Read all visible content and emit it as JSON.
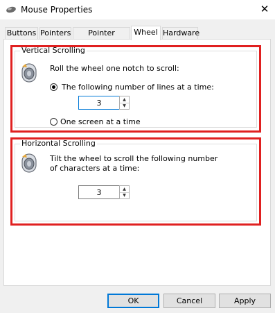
{
  "window": {
    "title": "Mouse Properties",
    "close_symbol": "✕"
  },
  "tabs": [
    {
      "label": "Buttons"
    },
    {
      "label": "Pointers"
    },
    {
      "label": "Pointer Options"
    },
    {
      "label": "Wheel",
      "active": true
    },
    {
      "label": "Hardware"
    }
  ],
  "vertical": {
    "group_label": "Vertical Scrolling",
    "prompt": "Roll the wheel one notch to scroll:",
    "option_lines_label": "The following number of lines at a time:",
    "option_lines_selected": true,
    "lines_value": "3",
    "option_screen_label": "One screen at a time",
    "option_screen_selected": false
  },
  "horizontal": {
    "group_label": "Horizontal Scrolling",
    "prompt_line1": "Tilt the wheel to scroll the following number",
    "prompt_line2": "of characters at a time:",
    "chars_value": "3"
  },
  "buttons": {
    "ok": "OK",
    "cancel": "Cancel",
    "apply": "Apply"
  },
  "colors": {
    "highlight_box": "#e02020",
    "focus_border": "#0078d7"
  },
  "icons": {
    "title": "mouse-icon",
    "wheel": "mouse-wheel-icon"
  }
}
